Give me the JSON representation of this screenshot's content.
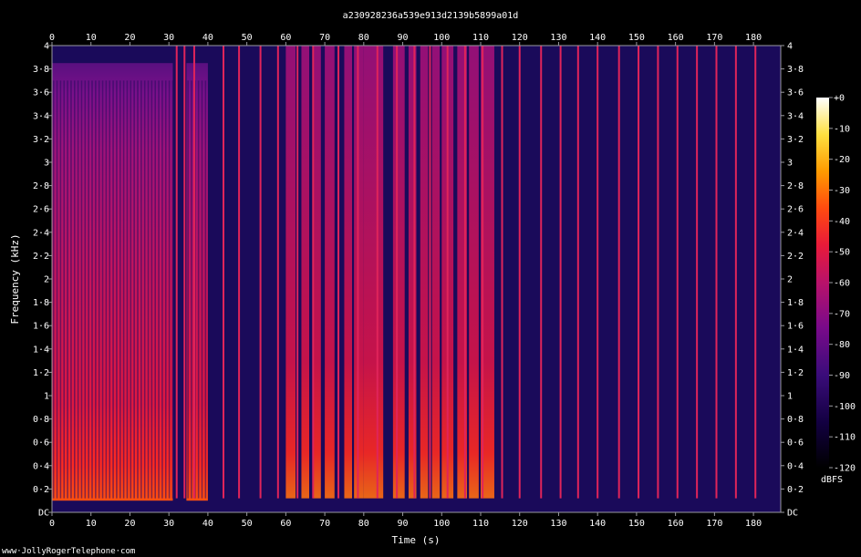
{
  "chart_data": {
    "type": "heatmap",
    "title": "a230928236a539e913d2139b5899a01d",
    "xlabel": "Time (s)",
    "ylabel": "Frequency (kHz)",
    "xlim": [
      0,
      187
    ],
    "ylim": [
      0,
      4
    ],
    "x_ticks": [
      0,
      10,
      20,
      30,
      40,
      50,
      60,
      70,
      80,
      90,
      100,
      110,
      120,
      130,
      140,
      150,
      160,
      170,
      180
    ],
    "y_ticks": [
      0,
      0.2,
      0.4,
      0.6,
      0.8,
      1,
      1.2,
      1.4,
      1.6,
      1.8,
      2,
      2.2,
      2.4,
      2.6,
      2.8,
      3,
      3.2,
      3.4,
      3.6,
      3.8,
      4
    ],
    "y_tick_labels": [
      "DC",
      "0·2",
      "0·4",
      "0·6",
      "0·8",
      "1",
      "1·2",
      "1·4",
      "1·6",
      "1·8",
      "2",
      "2·2",
      "2·4",
      "2·6",
      "2·8",
      "3",
      "3·2",
      "3·4",
      "3·6",
      "3·8",
      "4"
    ],
    "colorbar": {
      "label": "dBFS",
      "range": [
        -120,
        0
      ],
      "ticks": [
        0,
        -10,
        -20,
        -30,
        -40,
        -50,
        -60,
        -70,
        -80,
        -90,
        -100,
        -110,
        -120
      ],
      "tick_labels": [
        "+0",
        "-10",
        "-20",
        "-30",
        "-40",
        "-50",
        "-60",
        "-70",
        "-80",
        "-90",
        "-100",
        "-110",
        "-120"
      ],
      "colors": [
        "#000000",
        "#120040",
        "#3a0c7a",
        "#7a0a8a",
        "#b8126a",
        "#e81a3a",
        "#ff4a10",
        "#ff9a00",
        "#ffe040",
        "#ffffff"
      ]
    },
    "background_level_db": -110,
    "noise_floor_color": "#1a0a5a",
    "dense_speech_regions": [
      [
        0,
        31
      ],
      [
        34.5,
        40
      ]
    ],
    "voice_burst_regions": [
      [
        60,
        62.5
      ],
      [
        64,
        66
      ],
      [
        67,
        69
      ],
      [
        70,
        72.5
      ],
      [
        75,
        77
      ],
      [
        77.5,
        80
      ],
      [
        80,
        85
      ],
      [
        87.5,
        90.5
      ],
      [
        91.5,
        93.5
      ],
      [
        94.5,
        96.5
      ],
      [
        97.5,
        99.5
      ],
      [
        100,
        103
      ],
      [
        104,
        106.5
      ],
      [
        107,
        109.5
      ],
      [
        110,
        113.5
      ]
    ],
    "tone_pulse_times": [
      32,
      34,
      36.5,
      44,
      48,
      53.5,
      58,
      63,
      67,
      73.5,
      78.5,
      83.5,
      88.5,
      93,
      97,
      101.5,
      106,
      110.5,
      115.5,
      120,
      125.5,
      130.5,
      135,
      140,
      145.5,
      150.5,
      155.5,
      160.5,
      165.5,
      170.5,
      175.5,
      180.5
    ]
  },
  "footer": {
    "url": "www·JollyRogerTelephone·com"
  }
}
